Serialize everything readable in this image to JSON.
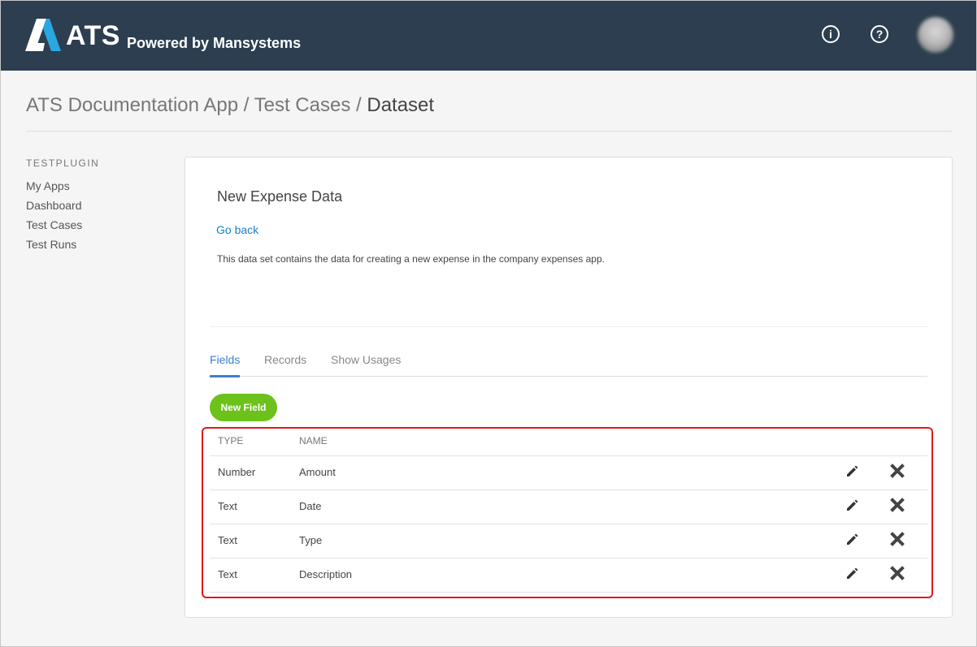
{
  "header": {
    "brand": "ATS",
    "tagline": "Powered by Mansystems",
    "info_icon": "info-circle-icon",
    "help_icon": "question-circle-icon",
    "info_glyph": "i",
    "help_glyph": "?",
    "bg_color": "#2c3e50"
  },
  "breadcrumb": {
    "app": "ATS Documentation App",
    "sep1": " / ",
    "section": "Test Cases",
    "sep2": " / ",
    "current": "Dataset"
  },
  "sidebar": {
    "title": "TESTPLUGIN",
    "items": [
      {
        "label": "My Apps"
      },
      {
        "label": "Dashboard"
      },
      {
        "label": "Test Cases"
      },
      {
        "label": "Test Runs"
      }
    ]
  },
  "dataset": {
    "title": "New Expense Data",
    "go_back": "Go back",
    "description": "This data set contains the data for creating a new expense in the company expenses app."
  },
  "tabs": [
    {
      "label": "Fields",
      "active": true
    },
    {
      "label": "Records",
      "active": false
    },
    {
      "label": "Show Usages",
      "active": false
    }
  ],
  "new_field_button": "New Field",
  "fields_table": {
    "headers": {
      "type": "TYPE",
      "name": "NAME"
    },
    "rows": [
      {
        "type": "Number",
        "name": "Amount"
      },
      {
        "type": "Text",
        "name": "Date"
      },
      {
        "type": "Text",
        "name": "Type"
      },
      {
        "type": "Text",
        "name": "Description"
      }
    ],
    "edit_icon": "pencil-icon",
    "delete_icon": "close-icon",
    "highlight_color": "#e01818"
  },
  "colors": {
    "accent": "#3d7fd0",
    "link": "#1a80c8",
    "button": "#6cc11a"
  }
}
